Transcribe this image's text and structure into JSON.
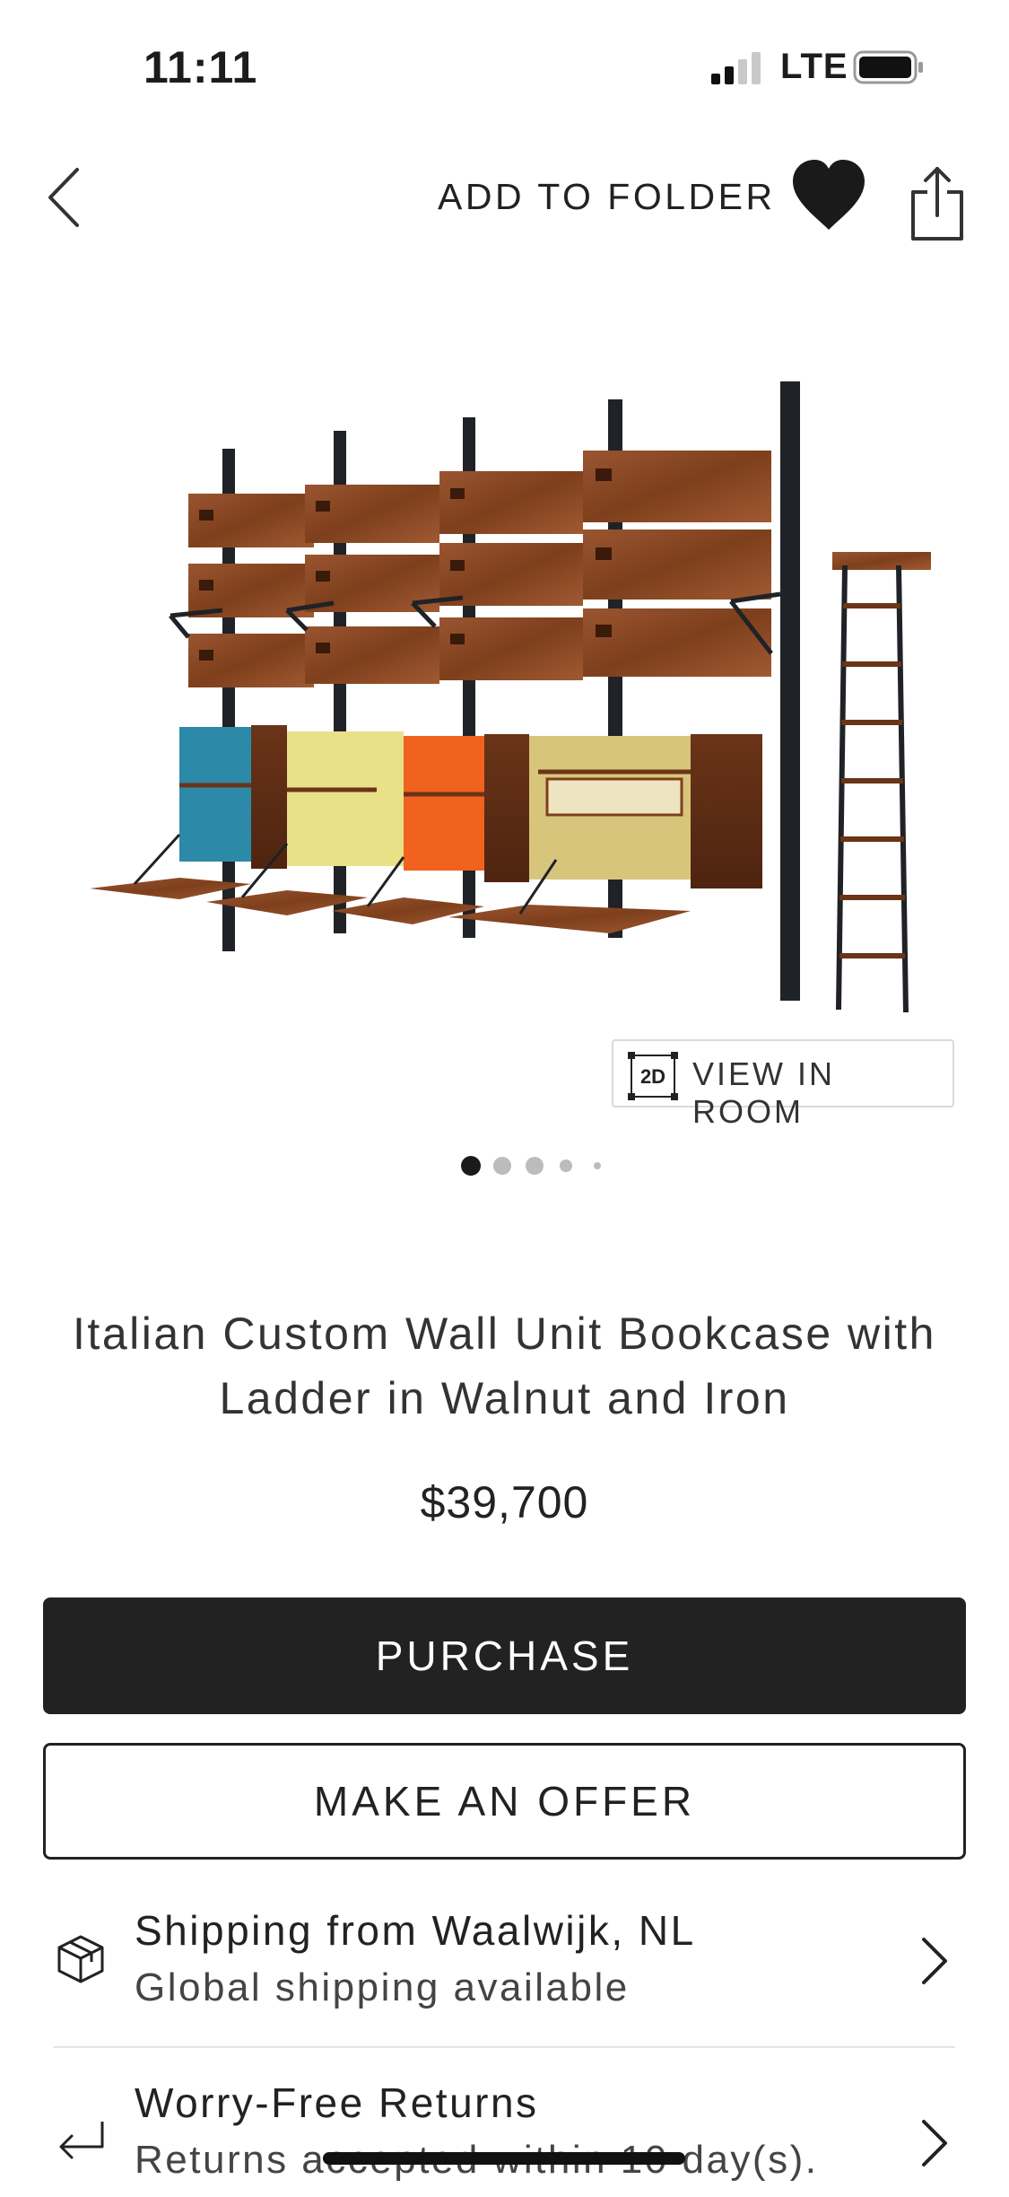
{
  "status_bar": {
    "time": "11:11",
    "network": "LTE"
  },
  "nav": {
    "add_to_folder": "ADD TO FOLDER"
  },
  "gallery": {
    "view_in_room": "VIEW IN ROOM",
    "view_badge": "2D",
    "page_count": 5,
    "current_page": 1
  },
  "product": {
    "title": "Italian Custom Wall Unit Bookcase with Ladder in Walnut and Iron",
    "price": "$39,700"
  },
  "actions": {
    "purchase": "PURCHASE",
    "make_offer": "MAKE AN OFFER"
  },
  "info_rows": [
    {
      "title": "Shipping from Waalwijk, NL",
      "subtitle": "Global shipping available",
      "icon": "package-icon"
    },
    {
      "title": "Worry-Free Returns",
      "subtitle": "Returns accepted within 10 day(s).",
      "icon": "return-arrow-icon"
    }
  ],
  "colors": {
    "primary_button": "#222222",
    "text": "#1c1c1c",
    "walnut": "#8a4a24",
    "iron": "#1f2226"
  }
}
